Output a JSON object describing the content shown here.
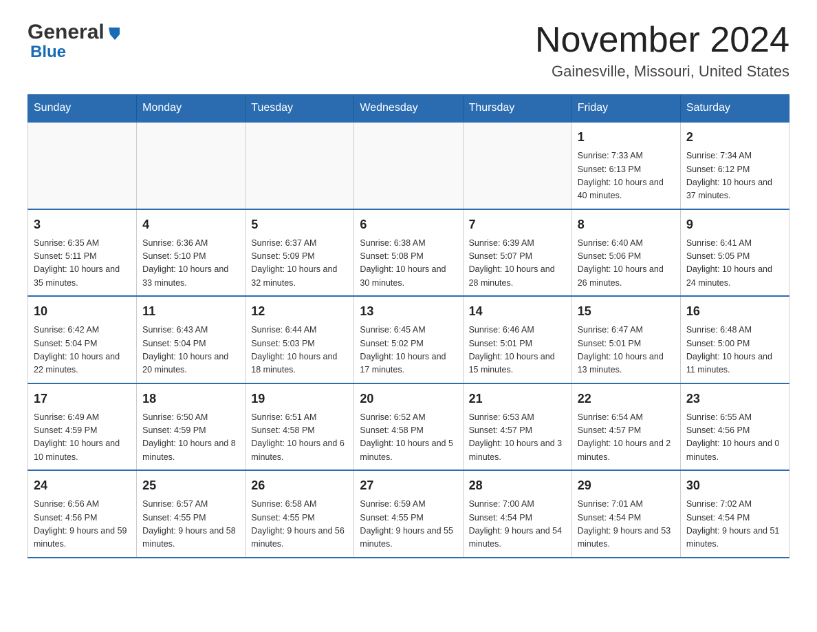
{
  "header": {
    "logo_general": "General",
    "logo_blue": "Blue",
    "month_title": "November 2024",
    "location": "Gainesville, Missouri, United States"
  },
  "weekdays": [
    "Sunday",
    "Monday",
    "Tuesday",
    "Wednesday",
    "Thursday",
    "Friday",
    "Saturday"
  ],
  "weeks": [
    [
      {
        "day": "",
        "info": ""
      },
      {
        "day": "",
        "info": ""
      },
      {
        "day": "",
        "info": ""
      },
      {
        "day": "",
        "info": ""
      },
      {
        "day": "",
        "info": ""
      },
      {
        "day": "1",
        "info": "Sunrise: 7:33 AM\nSunset: 6:13 PM\nDaylight: 10 hours and 40 minutes."
      },
      {
        "day": "2",
        "info": "Sunrise: 7:34 AM\nSunset: 6:12 PM\nDaylight: 10 hours and 37 minutes."
      }
    ],
    [
      {
        "day": "3",
        "info": "Sunrise: 6:35 AM\nSunset: 5:11 PM\nDaylight: 10 hours and 35 minutes."
      },
      {
        "day": "4",
        "info": "Sunrise: 6:36 AM\nSunset: 5:10 PM\nDaylight: 10 hours and 33 minutes."
      },
      {
        "day": "5",
        "info": "Sunrise: 6:37 AM\nSunset: 5:09 PM\nDaylight: 10 hours and 32 minutes."
      },
      {
        "day": "6",
        "info": "Sunrise: 6:38 AM\nSunset: 5:08 PM\nDaylight: 10 hours and 30 minutes."
      },
      {
        "day": "7",
        "info": "Sunrise: 6:39 AM\nSunset: 5:07 PM\nDaylight: 10 hours and 28 minutes."
      },
      {
        "day": "8",
        "info": "Sunrise: 6:40 AM\nSunset: 5:06 PM\nDaylight: 10 hours and 26 minutes."
      },
      {
        "day": "9",
        "info": "Sunrise: 6:41 AM\nSunset: 5:05 PM\nDaylight: 10 hours and 24 minutes."
      }
    ],
    [
      {
        "day": "10",
        "info": "Sunrise: 6:42 AM\nSunset: 5:04 PM\nDaylight: 10 hours and 22 minutes."
      },
      {
        "day": "11",
        "info": "Sunrise: 6:43 AM\nSunset: 5:04 PM\nDaylight: 10 hours and 20 minutes."
      },
      {
        "day": "12",
        "info": "Sunrise: 6:44 AM\nSunset: 5:03 PM\nDaylight: 10 hours and 18 minutes."
      },
      {
        "day": "13",
        "info": "Sunrise: 6:45 AM\nSunset: 5:02 PM\nDaylight: 10 hours and 17 minutes."
      },
      {
        "day": "14",
        "info": "Sunrise: 6:46 AM\nSunset: 5:01 PM\nDaylight: 10 hours and 15 minutes."
      },
      {
        "day": "15",
        "info": "Sunrise: 6:47 AM\nSunset: 5:01 PM\nDaylight: 10 hours and 13 minutes."
      },
      {
        "day": "16",
        "info": "Sunrise: 6:48 AM\nSunset: 5:00 PM\nDaylight: 10 hours and 11 minutes."
      }
    ],
    [
      {
        "day": "17",
        "info": "Sunrise: 6:49 AM\nSunset: 4:59 PM\nDaylight: 10 hours and 10 minutes."
      },
      {
        "day": "18",
        "info": "Sunrise: 6:50 AM\nSunset: 4:59 PM\nDaylight: 10 hours and 8 minutes."
      },
      {
        "day": "19",
        "info": "Sunrise: 6:51 AM\nSunset: 4:58 PM\nDaylight: 10 hours and 6 minutes."
      },
      {
        "day": "20",
        "info": "Sunrise: 6:52 AM\nSunset: 4:58 PM\nDaylight: 10 hours and 5 minutes."
      },
      {
        "day": "21",
        "info": "Sunrise: 6:53 AM\nSunset: 4:57 PM\nDaylight: 10 hours and 3 minutes."
      },
      {
        "day": "22",
        "info": "Sunrise: 6:54 AM\nSunset: 4:57 PM\nDaylight: 10 hours and 2 minutes."
      },
      {
        "day": "23",
        "info": "Sunrise: 6:55 AM\nSunset: 4:56 PM\nDaylight: 10 hours and 0 minutes."
      }
    ],
    [
      {
        "day": "24",
        "info": "Sunrise: 6:56 AM\nSunset: 4:56 PM\nDaylight: 9 hours and 59 minutes."
      },
      {
        "day": "25",
        "info": "Sunrise: 6:57 AM\nSunset: 4:55 PM\nDaylight: 9 hours and 58 minutes."
      },
      {
        "day": "26",
        "info": "Sunrise: 6:58 AM\nSunset: 4:55 PM\nDaylight: 9 hours and 56 minutes."
      },
      {
        "day": "27",
        "info": "Sunrise: 6:59 AM\nSunset: 4:55 PM\nDaylight: 9 hours and 55 minutes."
      },
      {
        "day": "28",
        "info": "Sunrise: 7:00 AM\nSunset: 4:54 PM\nDaylight: 9 hours and 54 minutes."
      },
      {
        "day": "29",
        "info": "Sunrise: 7:01 AM\nSunset: 4:54 PM\nDaylight: 9 hours and 53 minutes."
      },
      {
        "day": "30",
        "info": "Sunrise: 7:02 AM\nSunset: 4:54 PM\nDaylight: 9 hours and 51 minutes."
      }
    ]
  ]
}
